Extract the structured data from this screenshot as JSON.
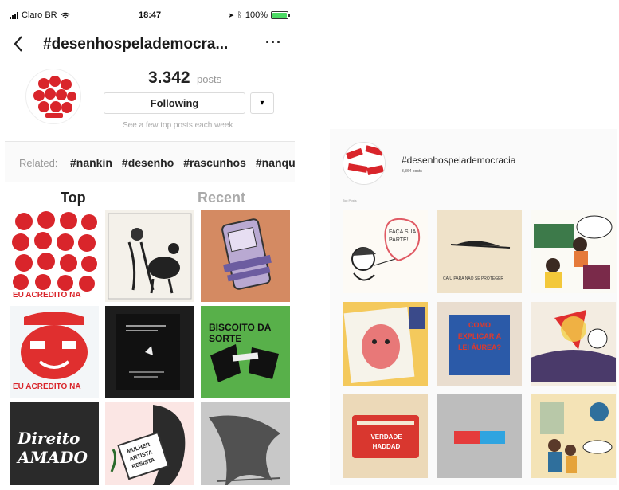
{
  "status_bar": {
    "carrier": "Claro BR",
    "time": "18:47",
    "battery": "100%"
  },
  "nav": {
    "back_icon": "chevron-left-icon",
    "title": "#desenhospelademocra...",
    "more": "···"
  },
  "header": {
    "post_count": "3.342",
    "post_count_label": "posts",
    "follow_label": "Following",
    "follow_caret": "▾",
    "top_posts_hint": "See a few top posts each week"
  },
  "related": {
    "label": "Related:",
    "tags": [
      "#nankin",
      "#desenho",
      "#rascunhos",
      "#nanqui"
    ]
  },
  "tabs": {
    "top": "Top",
    "recent": "Recent"
  },
  "posts": [
    {
      "bg": "#ffffff",
      "accent": "#d9252b",
      "text": "EU ACREDITO NA",
      "text_color": "#d9252b"
    },
    {
      "bg": "#f4f1ea",
      "accent": "#222222",
      "text": "",
      "text_color": "#222222"
    },
    {
      "bg": "#d48a62",
      "accent": "#b9a9d2",
      "text": "",
      "text_color": "#222222"
    },
    {
      "bg": "#f3f6f8",
      "accent": "#e02f2f",
      "text": "EU ACREDITO NA",
      "text_color": "#d9252b"
    },
    {
      "bg": "#1d1d1d",
      "accent": "#ffffff",
      "text": "",
      "text_color": "#ffffff"
    },
    {
      "bg": "#58b04a",
      "accent": "#111111",
      "text": "BISCOITO DA SORTE",
      "text_color": "#111111"
    },
    {
      "bg": "#2a2a2a",
      "accent": "#ffffff",
      "text": "Direito AMADO",
      "text_color": "#ffffff"
    },
    {
      "bg": "#fbe6e4",
      "accent": "#3b3b3b",
      "text": "MULHER ARTISTA RESISTA",
      "text_color": "#222222"
    },
    {
      "bg": "#8a8a8a",
      "accent": "#2a2a2a",
      "text": "",
      "text_color": "#222222"
    }
  ],
  "web": {
    "title": "#desenhospelademocracia",
    "post_count": "3,364 posts",
    "section_label": "Top Posts",
    "posts": [
      {
        "bg": "#fdfaf5",
        "accent": "#e05a64",
        "text": "FAÇA SUA PARTE!",
        "text_color": "#333333"
      },
      {
        "bg": "#efe2c9",
        "accent": "#222222",
        "text": "CAIU PARA NÃO SE PROTEGER",
        "text_color": "#333333"
      },
      {
        "bg": "#fbfaf5",
        "accent": "#2a2a2a",
        "text": "",
        "text_color": "#222222"
      },
      {
        "bg": "#f4c95c",
        "accent": "#e87878",
        "text": "",
        "text_color": "#333333"
      },
      {
        "bg": "#e9ddcf",
        "accent": "#2b5aa8",
        "text": "COMO EXPLICAR A LEI ÁUREA?",
        "text_color": "#d33a2c"
      },
      {
        "bg": "#f3ece1",
        "accent": "#c23a3a",
        "text": "",
        "text_color": "#222222"
      },
      {
        "bg": "#ecd9b8",
        "accent": "#d9372f",
        "text": "VERDADE HADDAD",
        "text_color": "#ffffff"
      },
      {
        "bg": "#bdbdbd",
        "accent": "#e53b3b",
        "text": "",
        "text_color": "#ffffff"
      },
      {
        "bg": "#f4e3b6",
        "accent": "#2f6f9c",
        "text": "",
        "text_color": "#222222"
      }
    ]
  },
  "colors": {
    "ig_text": "#262626",
    "muted": "#999999",
    "border": "#dbdbdb"
  }
}
